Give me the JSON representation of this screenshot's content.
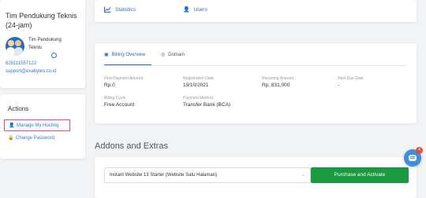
{
  "support": {
    "title": "Tim Pendukung Teknis (24-jam)",
    "agent_name": "Tim Pendukung Teknis",
    "phone": "628111557122",
    "email": "support@exabytes.co.id"
  },
  "actions": {
    "title": "Actions",
    "items": [
      {
        "label": "Manage My Hosting",
        "icon": "user-icon",
        "active": true
      },
      {
        "label": "Change Password",
        "icon": "lock-icon",
        "active": false
      }
    ]
  },
  "top_links": {
    "statistics": "Statistics",
    "users": "Users"
  },
  "billing": {
    "tabs": [
      {
        "label": "Billing Overview",
        "icon": "billing-icon",
        "active": true
      },
      {
        "label": "Domain",
        "icon": "globe-icon",
        "active": false
      }
    ],
    "fields": {
      "first_payment": {
        "label": "First Payment Amount",
        "value": "Rp.0"
      },
      "registration_date": {
        "label": "Registration Date",
        "value": "19/10/2021"
      },
      "recurring_amount": {
        "label": "Recurring Amount",
        "value": "Rp. 831,000"
      },
      "next_due_date": {
        "label": "Next Due Date",
        "value": "-"
      },
      "billing_cycle": {
        "label": "Billing Cycle",
        "value": "Free Account"
      },
      "payment_method": {
        "label": "Payment Method",
        "value": "Transfer Bank (BCA)"
      }
    }
  },
  "addons": {
    "title": "Addons and Extras",
    "selected_option": "Instant Website 13 Starter (Website Satu Halaman)",
    "purchase_label": "Purchase and Activate"
  },
  "chat": {
    "badge_count": "4"
  },
  "colors": {
    "accent": "#2e6fc0",
    "purchase_green": "#1a9a3e",
    "highlight_pink": "#e0499b",
    "chat_blue": "#3b8ee0",
    "badge_red": "#e64b3c"
  }
}
